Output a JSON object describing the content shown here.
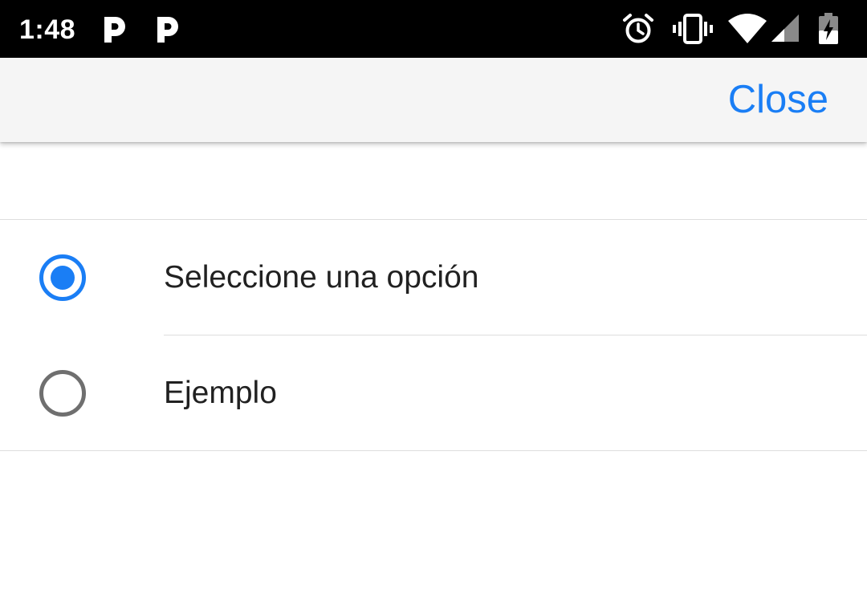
{
  "status_bar": {
    "time": "1:48",
    "app_icons": [
      "p-app-icon",
      "p-app-icon"
    ],
    "system_icons": [
      "alarm-icon",
      "vibrate-icon",
      "wifi-icon",
      "cell-signal-icon",
      "battery-charging-icon"
    ]
  },
  "toolbar": {
    "close_label": "Close"
  },
  "options": [
    {
      "label": "Seleccione una opción",
      "selected": true
    },
    {
      "label": "Ejemplo",
      "selected": false
    }
  ],
  "colors": {
    "accent": "#1a7ef5",
    "radio_unselected": "#6f6f6f",
    "divider": "#dedede",
    "toolbar_bg": "#f5f5f5"
  }
}
